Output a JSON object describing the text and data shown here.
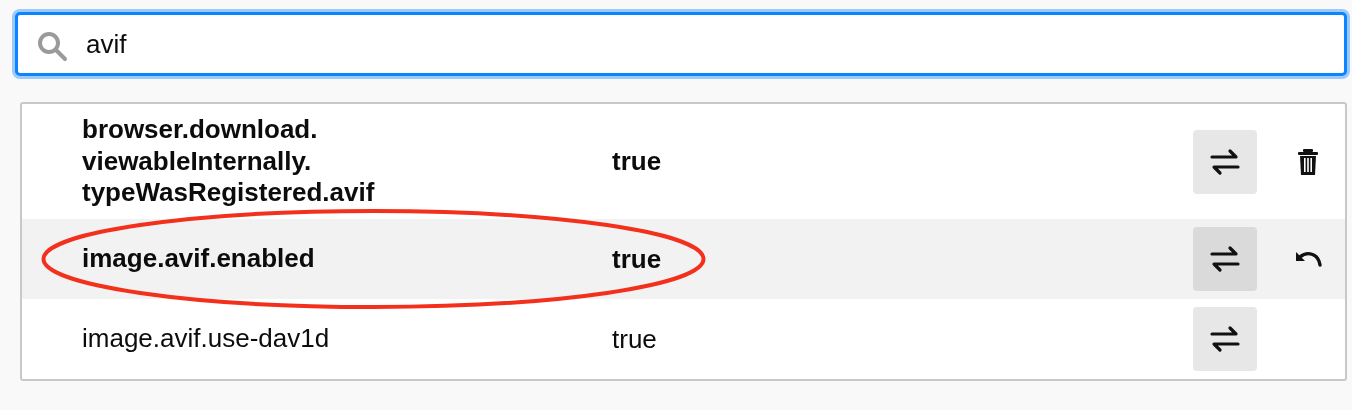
{
  "search": {
    "value": "avif"
  },
  "prefs": [
    {
      "name": "browser.download.viewableInternally.typeWasRegistered.avif",
      "value": "true",
      "modified": true,
      "highlighted": false,
      "circled": false,
      "deletable": true,
      "resettable": false
    },
    {
      "name": "image.avif.enabled",
      "value": "true",
      "modified": true,
      "highlighted": true,
      "circled": true,
      "deletable": false,
      "resettable": true
    },
    {
      "name": "image.avif.use-dav1d",
      "value": "true",
      "modified": false,
      "highlighted": false,
      "circled": false,
      "deletable": false,
      "resettable": false
    }
  ]
}
